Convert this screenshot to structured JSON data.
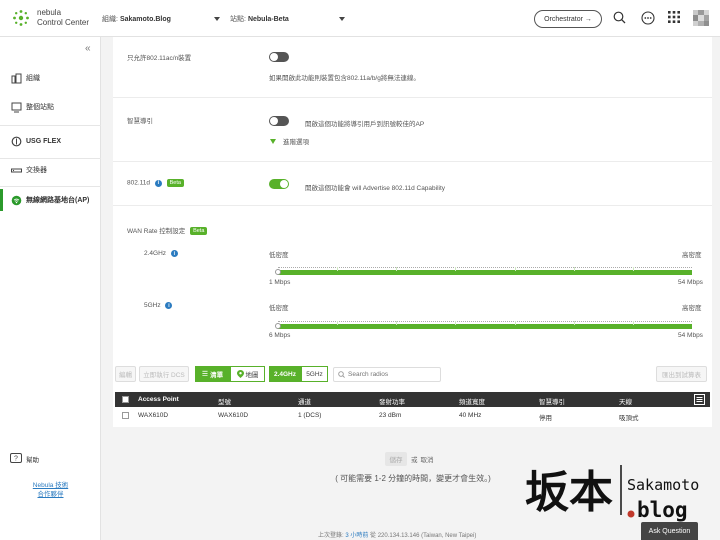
{
  "app": {
    "logo_line1": "nebula",
    "logo_line2": "Control Center"
  },
  "header": {
    "org_label": "組織:",
    "org_value": "Sakamoto.Blog",
    "site_label": "站點:",
    "site_value": "Nebula-Beta",
    "orchestrator_label": "Orchestrator →",
    "icons": [
      "search-icon",
      "chat-icon",
      "apps-grid-icon",
      "avatar"
    ]
  },
  "sidebar": {
    "items": [
      {
        "label": "組織",
        "icon": "org-chart-icon"
      },
      {
        "label": "整個站點",
        "icon": "site-icon"
      },
      {
        "label": "USG FLEX",
        "icon": "firewall-icon"
      },
      {
        "label": "交換器",
        "icon": "switch-icon"
      },
      {
        "label": "無線網路基地台(AP)",
        "icon": "wifi-icon"
      }
    ],
    "help_label": "幫助",
    "link_line1": "Nebula 技術",
    "link_line2": "合作夥伴"
  },
  "settings": {
    "ac_only": {
      "label": "只允許802.11ac/n裝置",
      "enabled": false,
      "desc": "如果開啟此功能則裝置包含802.11a/b/g將無法連線。"
    },
    "steering": {
      "label": "智慧導引",
      "enabled": false,
      "desc": "開啟這個功能將導引用戶到訊號較佳的AP",
      "advanced_label": "進階選項"
    },
    "dot11d": {
      "label": "802.11d",
      "beta": "Beta",
      "enabled": true,
      "desc": "開啟這個功能會 will Advertise 802.11d Capability"
    },
    "wan_rate": {
      "label": "WAN Rate 控制設定",
      "beta": "Beta",
      "bands": [
        {
          "name": "2.4GHz",
          "low_label": "低密度",
          "high_label": "高密度",
          "min": "1 Mbps",
          "max": "54 Mbps",
          "level": 0
        },
        {
          "name": "5GHz",
          "low_label": "低密度",
          "high_label": "高密度",
          "min": "6 Mbps",
          "max": "54 Mbps",
          "level": 0
        }
      ]
    }
  },
  "toolbar": {
    "edit_label": "編輯",
    "dcs_label": "立即執行 DCS",
    "list_label": "清單",
    "map_label": "地圖",
    "band_24": "2.4GHz",
    "band_5": "5GHz",
    "search_placeholder": "Search radios",
    "export_label": "匯出到試算表"
  },
  "table": {
    "headers": [
      "Access Point",
      "型號",
      "通道",
      "發射功率",
      "頻道寬度",
      "智慧導引",
      "天線"
    ],
    "rows": [
      [
        "WAX610D",
        "WAX610D",
        "1 (DCS)",
        "23 dBm",
        "40 MHz",
        "停用",
        "吸頂式"
      ]
    ]
  },
  "footer": {
    "save_label": "儲存",
    "or_label": "或",
    "cancel_label": "取消",
    "note": "( 可能需要 1-2 分鐘的時間，變更才會生效。)",
    "status_prefix": "上次登錄:",
    "status_time": "3 小時前",
    "status_from": "從",
    "status_ip": "220.134.13.146 (Taiwan, New Taipei)",
    "ask_label": "Ask Question"
  },
  "watermark": {
    "kanji": "坂本",
    "line1": "Sakamoto",
    "line2": ".blog"
  },
  "colors": {
    "accent": "#58b12a",
    "link": "#2b7bc0",
    "header_dark": "#333333"
  }
}
